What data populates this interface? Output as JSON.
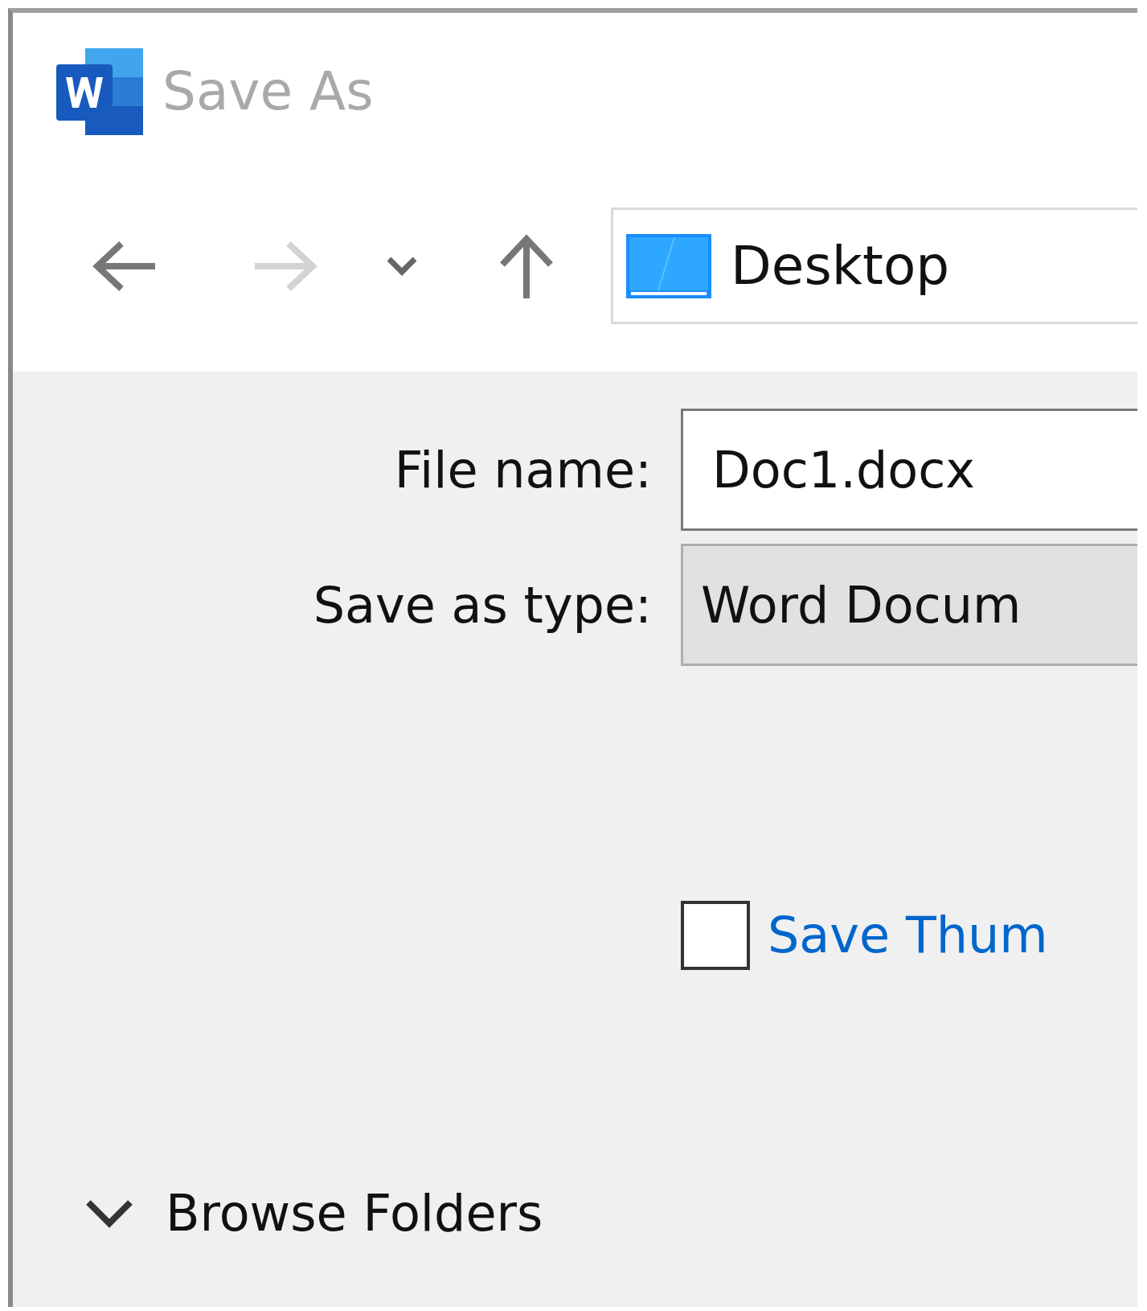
{
  "window": {
    "title": "Save As"
  },
  "nav": {
    "back": {
      "disabled": false
    },
    "forward": {
      "disabled": true
    },
    "up": {
      "disabled": false
    }
  },
  "location": {
    "text": "Desktop"
  },
  "fields": [
    {
      "label": "File name:",
      "value": "Doc1.docx",
      "kind": "input"
    },
    {
      "label": "Save as type:",
      "value": "Word Docum",
      "kind": "select"
    }
  ],
  "thumbnail": {
    "label": "Save Thum",
    "checked": false
  },
  "browse": {
    "label": "Browse Folders",
    "expanded": false
  }
}
